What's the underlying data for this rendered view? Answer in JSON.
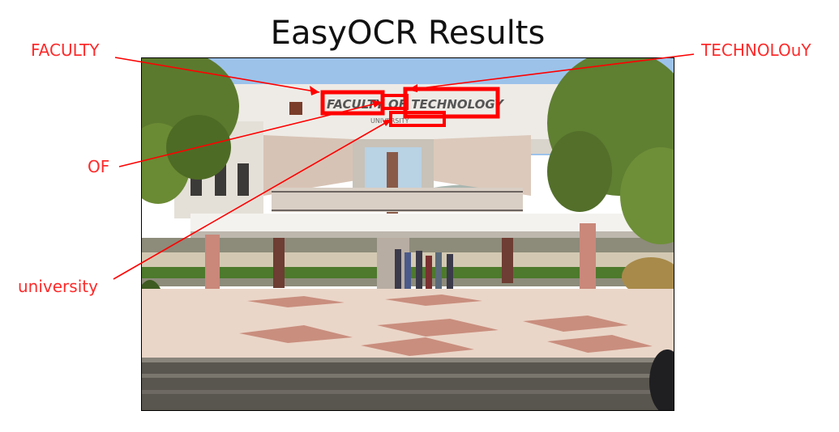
{
  "figure": {
    "title": "EasyOCR Results"
  },
  "detections": [
    {
      "text": "FACULTY"
    },
    {
      "text": "OF"
    },
    {
      "text": "TECHNOLOuY"
    },
    {
      "text": "university"
    }
  ],
  "photo": {
    "sign_text": "FACULTY OF TECHNOLOGY",
    "sign_subtext": "UNIVERSITY"
  },
  "colors": {
    "annotation": "#ff2a2a",
    "sky": "#8fb9e6",
    "building": "#ece9e3",
    "pillar": "#c9887a",
    "tree": "#5c7a2e",
    "floor": "#e8d3c4",
    "floor_tile": "#c98e7e",
    "steps": "#4d4b48"
  }
}
